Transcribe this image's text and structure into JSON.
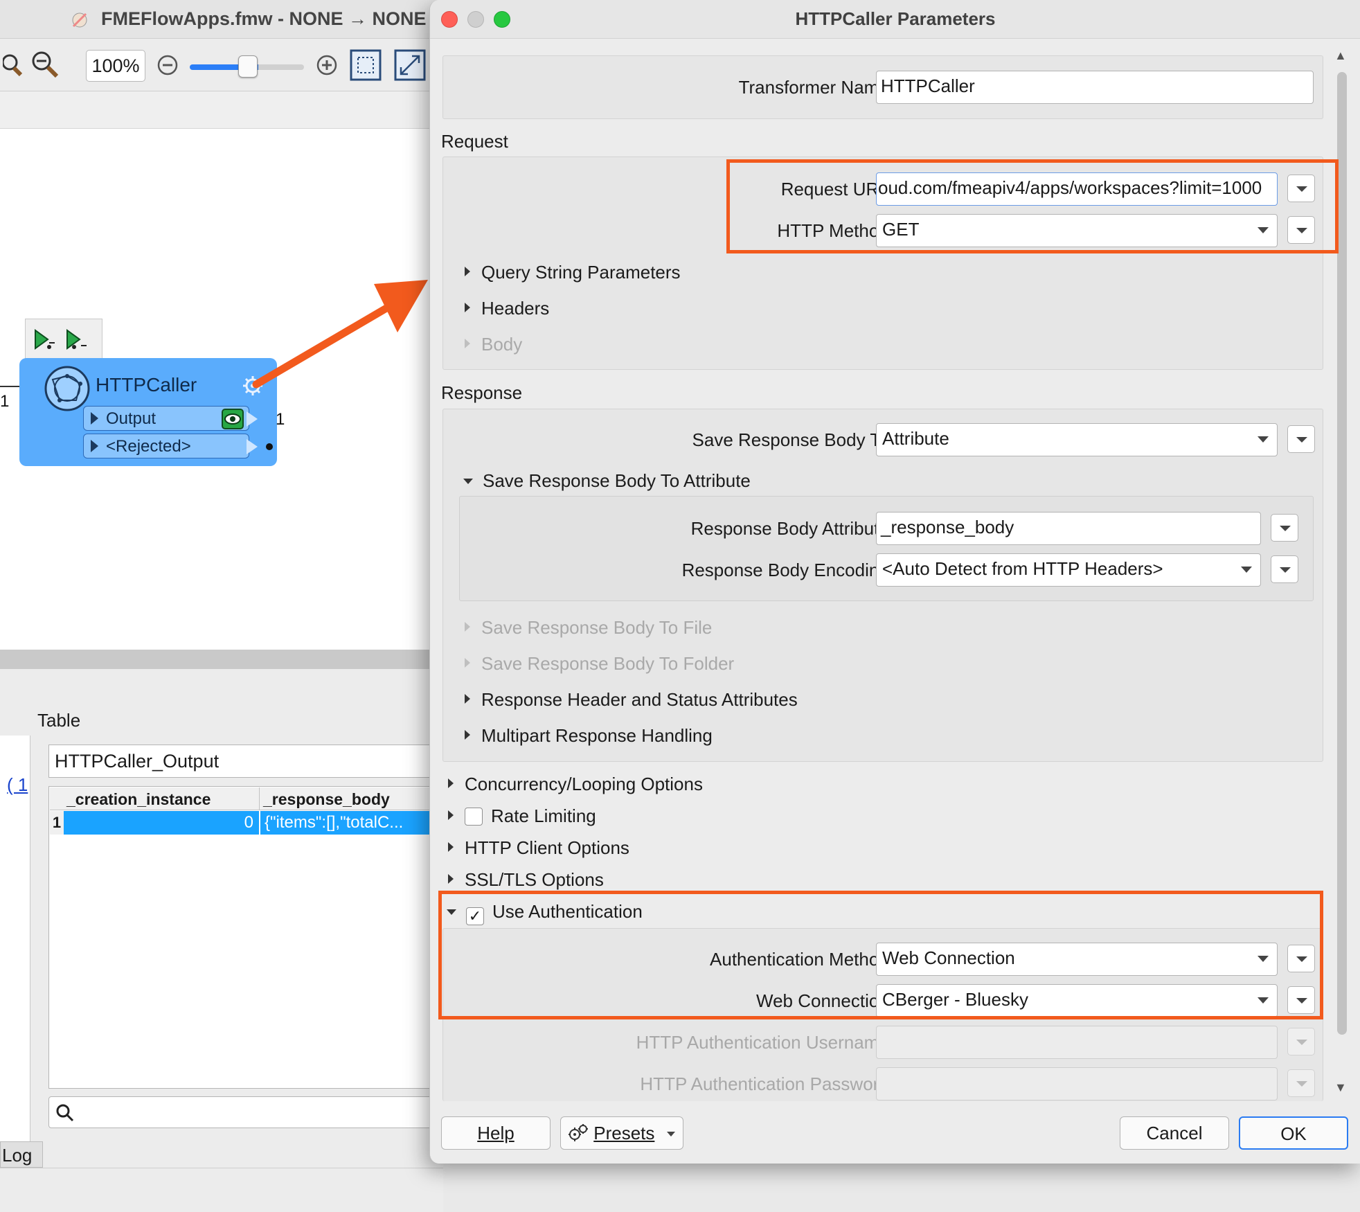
{
  "background_app": {
    "window_title": "FMEFlowApps.fmw - NONE → NONE -",
    "zoom_value": "100%",
    "table_label": "Table",
    "table_link_text": "( 1",
    "output_name": "HTTPCaller_Output",
    "columns": [
      "_creation_instance",
      "_response_body"
    ],
    "rows": [
      {
        "index": "1",
        "creation_instance": "0",
        "response_body": "{\"items\":[],\"totalC..."
      }
    ],
    "log_tab": "Log"
  },
  "node": {
    "name": "HTTPCaller",
    "ports": [
      {
        "label": "Output",
        "count": "1"
      },
      {
        "label": "<Rejected>",
        "count": ""
      }
    ],
    "input_count": "1"
  },
  "dialog": {
    "title": "HTTPCaller Parameters",
    "transformer_name_label": "Transformer Name:",
    "transformer_name_value": "HTTPCaller",
    "request": {
      "section_title": "Request",
      "url_label": "Request URL:",
      "url_value": "oud.com/fmeapiv4/apps/workspaces?limit=1000",
      "method_label": "HTTP Method:",
      "method_value": "GET",
      "groups": [
        "Query String Parameters",
        "Headers",
        "Body"
      ]
    },
    "response": {
      "section_title": "Response",
      "save_to_label": "Save Response Body To:",
      "save_to_value": "Attribute",
      "subgroup_title": "Save Response Body To Attribute",
      "body_attr_label": "Response Body Attribute:",
      "body_attr_value": "_response_body",
      "encoding_label": "Response Body Encoding:",
      "encoding_value": "<Auto Detect from HTTP Headers>",
      "groups": [
        "Save Response Body To File",
        "Save Response Body To Folder",
        "Response Header and Status Attributes",
        "Multipart Response Handling"
      ]
    },
    "options": [
      "Concurrency/Looping Options",
      "Rate Limiting",
      "HTTP Client Options",
      "SSL/TLS Options"
    ],
    "auth": {
      "title": "Use Authentication",
      "checked": true,
      "check_mark": "✓",
      "method_label": "Authentication Method:",
      "method_value": "Web Connection",
      "connection_label": "Web Connection:",
      "connection_value": "CBerger - Bluesky",
      "username_label": "HTTP Authentication Username:",
      "password_label": "HTTP Authentication Password:"
    },
    "buttons": {
      "help": "Help",
      "presets": "Presets",
      "cancel": "Cancel",
      "ok": "OK"
    }
  },
  "colors": {
    "highlight": "#f25a1d",
    "node_fill": "#5aacfc",
    "selection": "#1aa3ff",
    "close": "#fe5f57",
    "minimize": "#c9c9c9",
    "maximize": "#27c840"
  }
}
